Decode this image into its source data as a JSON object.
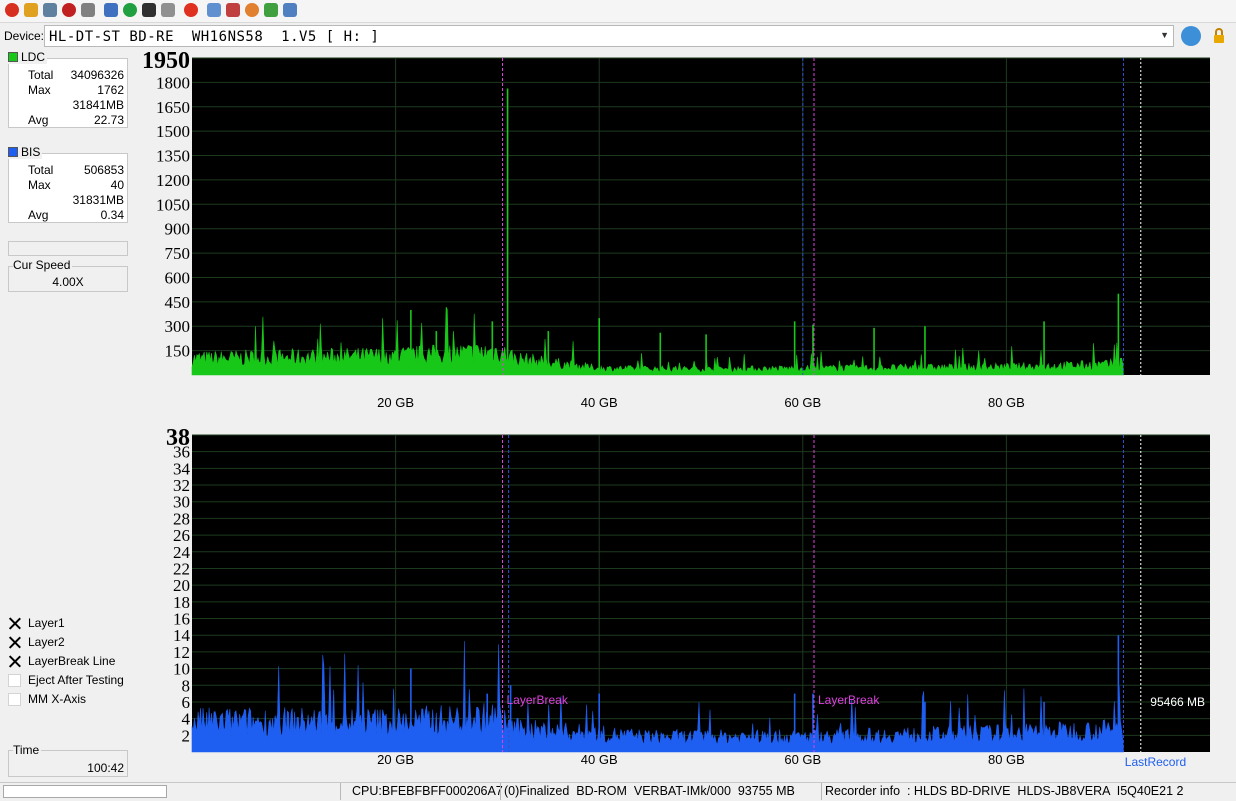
{
  "device": {
    "label": "Device:",
    "name": "HL-DT-ST BD-RE  WH16NS58  1.V5 [ H: ]"
  },
  "toolbar_icons": [
    "power-icon",
    "tool-icon",
    "drive-icon",
    "burn-icon",
    "eraser-icon",
    "copy-icon",
    "refresh-icon",
    "disc-info-icon",
    "eject-icon",
    "stop-icon",
    "media-icon",
    "record-icon",
    "settings-icon",
    "chart-icon",
    "save-icon"
  ],
  "ldc": {
    "title": "LDC",
    "color": "#18c818",
    "total_label": "Total",
    "total": "34096326",
    "max_label": "Max",
    "max": "1762",
    "max_pos": "31841MB",
    "avg_label": "Avg",
    "avg": "22.73"
  },
  "bis": {
    "title": "BIS",
    "color": "#1e5ef0",
    "total_label": "Total",
    "total": "506853",
    "max_label": "Max",
    "max": "40",
    "max_pos": "31831MB",
    "avg_label": "Avg",
    "avg": "0.34"
  },
  "speed": {
    "title": "Cur Speed",
    "value": "4.00X"
  },
  "options": [
    {
      "label": "Layer1",
      "checked": true
    },
    {
      "label": "Layer2",
      "checked": true
    },
    {
      "label": "LayerBreak Line",
      "checked": true
    },
    {
      "label": "Eject After Testing",
      "checked": false
    },
    {
      "label": "MM X-Axis",
      "checked": false
    }
  ],
  "time": {
    "title": "Time",
    "value": "100:42"
  },
  "statusbar": {
    "cpu": "CPU:BFEBFBFF000206A7",
    "disc": "(0)Finalized  BD-ROM  VERBAT-IMk/000  93755 MB",
    "recorder": "Recorder info  : HLDS BD-DRIVE  HLDS-JB8VERA  I5Q40E21 2"
  },
  "chart_data": [
    {
      "type": "area",
      "name": "LDC",
      "color": "#18c818",
      "ylim": [
        0,
        1950
      ],
      "y_ticks": [
        150,
        300,
        450,
        600,
        750,
        900,
        1050,
        1200,
        1350,
        1500,
        1650,
        1800,
        1950
      ],
      "x_ticks": [
        20,
        40,
        60,
        80
      ],
      "x_tick_labels": [
        "20 GB",
        "40 GB",
        "60 GB",
        "80 GB"
      ],
      "xlim_gb": [
        0,
        100
      ],
      "data_end_gb": 91.5,
      "baseline_profile": [
        [
          0,
          110
        ],
        [
          10,
          120
        ],
        [
          20,
          130
        ],
        [
          28,
          150
        ],
        [
          30,
          160
        ],
        [
          32,
          110
        ],
        [
          40,
          45
        ],
        [
          50,
          40
        ],
        [
          60,
          45
        ],
        [
          70,
          50
        ],
        [
          80,
          55
        ],
        [
          90,
          70
        ],
        [
          91.5,
          90
        ]
      ],
      "peaks": [
        [
          31.0,
          1762
        ],
        [
          21.5,
          400
        ],
        [
          29.5,
          330
        ],
        [
          40.0,
          350
        ],
        [
          59.2,
          330
        ],
        [
          61.0,
          310
        ],
        [
          67.0,
          290
        ],
        [
          72.0,
          300
        ],
        [
          83.7,
          330
        ],
        [
          91.0,
          500
        ],
        [
          35.0,
          270
        ],
        [
          50.5,
          250
        ],
        [
          46.0,
          260
        ],
        [
          24.0,
          270
        ]
      ],
      "layer_breaks_gb": [
        30.5,
        61.1
      ],
      "extra_lines_gb": [
        60.0,
        91.5
      ],
      "end_marker_gb": 93.2
    },
    {
      "type": "area",
      "name": "BIS",
      "color": "#1e5ef0",
      "ylim": [
        0,
        38
      ],
      "y_ticks": [
        2,
        4,
        6,
        8,
        10,
        12,
        14,
        16,
        18,
        20,
        22,
        24,
        26,
        28,
        30,
        32,
        34,
        36,
        38
      ],
      "x_ticks": [
        20,
        40,
        60,
        80
      ],
      "x_tick_labels": [
        "20 GB",
        "40 GB",
        "60 GB",
        "80 GB"
      ],
      "xlim_gb": [
        0,
        100
      ],
      "data_end_gb": 91.5,
      "baseline_profile": [
        [
          0,
          4
        ],
        [
          20,
          4
        ],
        [
          30,
          4.5
        ],
        [
          32,
          3
        ],
        [
          45,
          2
        ],
        [
          60,
          2
        ],
        [
          80,
          2.5
        ],
        [
          91.5,
          3
        ]
      ],
      "peaks": [
        [
          21.5,
          10
        ],
        [
          31.3,
          8
        ],
        [
          40.0,
          7
        ],
        [
          59.2,
          7
        ],
        [
          61.0,
          7
        ],
        [
          72.0,
          6
        ],
        [
          83.7,
          6
        ],
        [
          91.0,
          14
        ],
        [
          29.0,
          7
        ]
      ],
      "layer_breaks_gb": [
        30.5,
        61.1
      ],
      "layer_break_label": "LayerBreak",
      "extra_lines_gb": [
        31.1,
        91.5
      ],
      "end_marker_gb": 93.2,
      "end_label": "95466 MB",
      "last_record_label": "LastRecord"
    }
  ]
}
